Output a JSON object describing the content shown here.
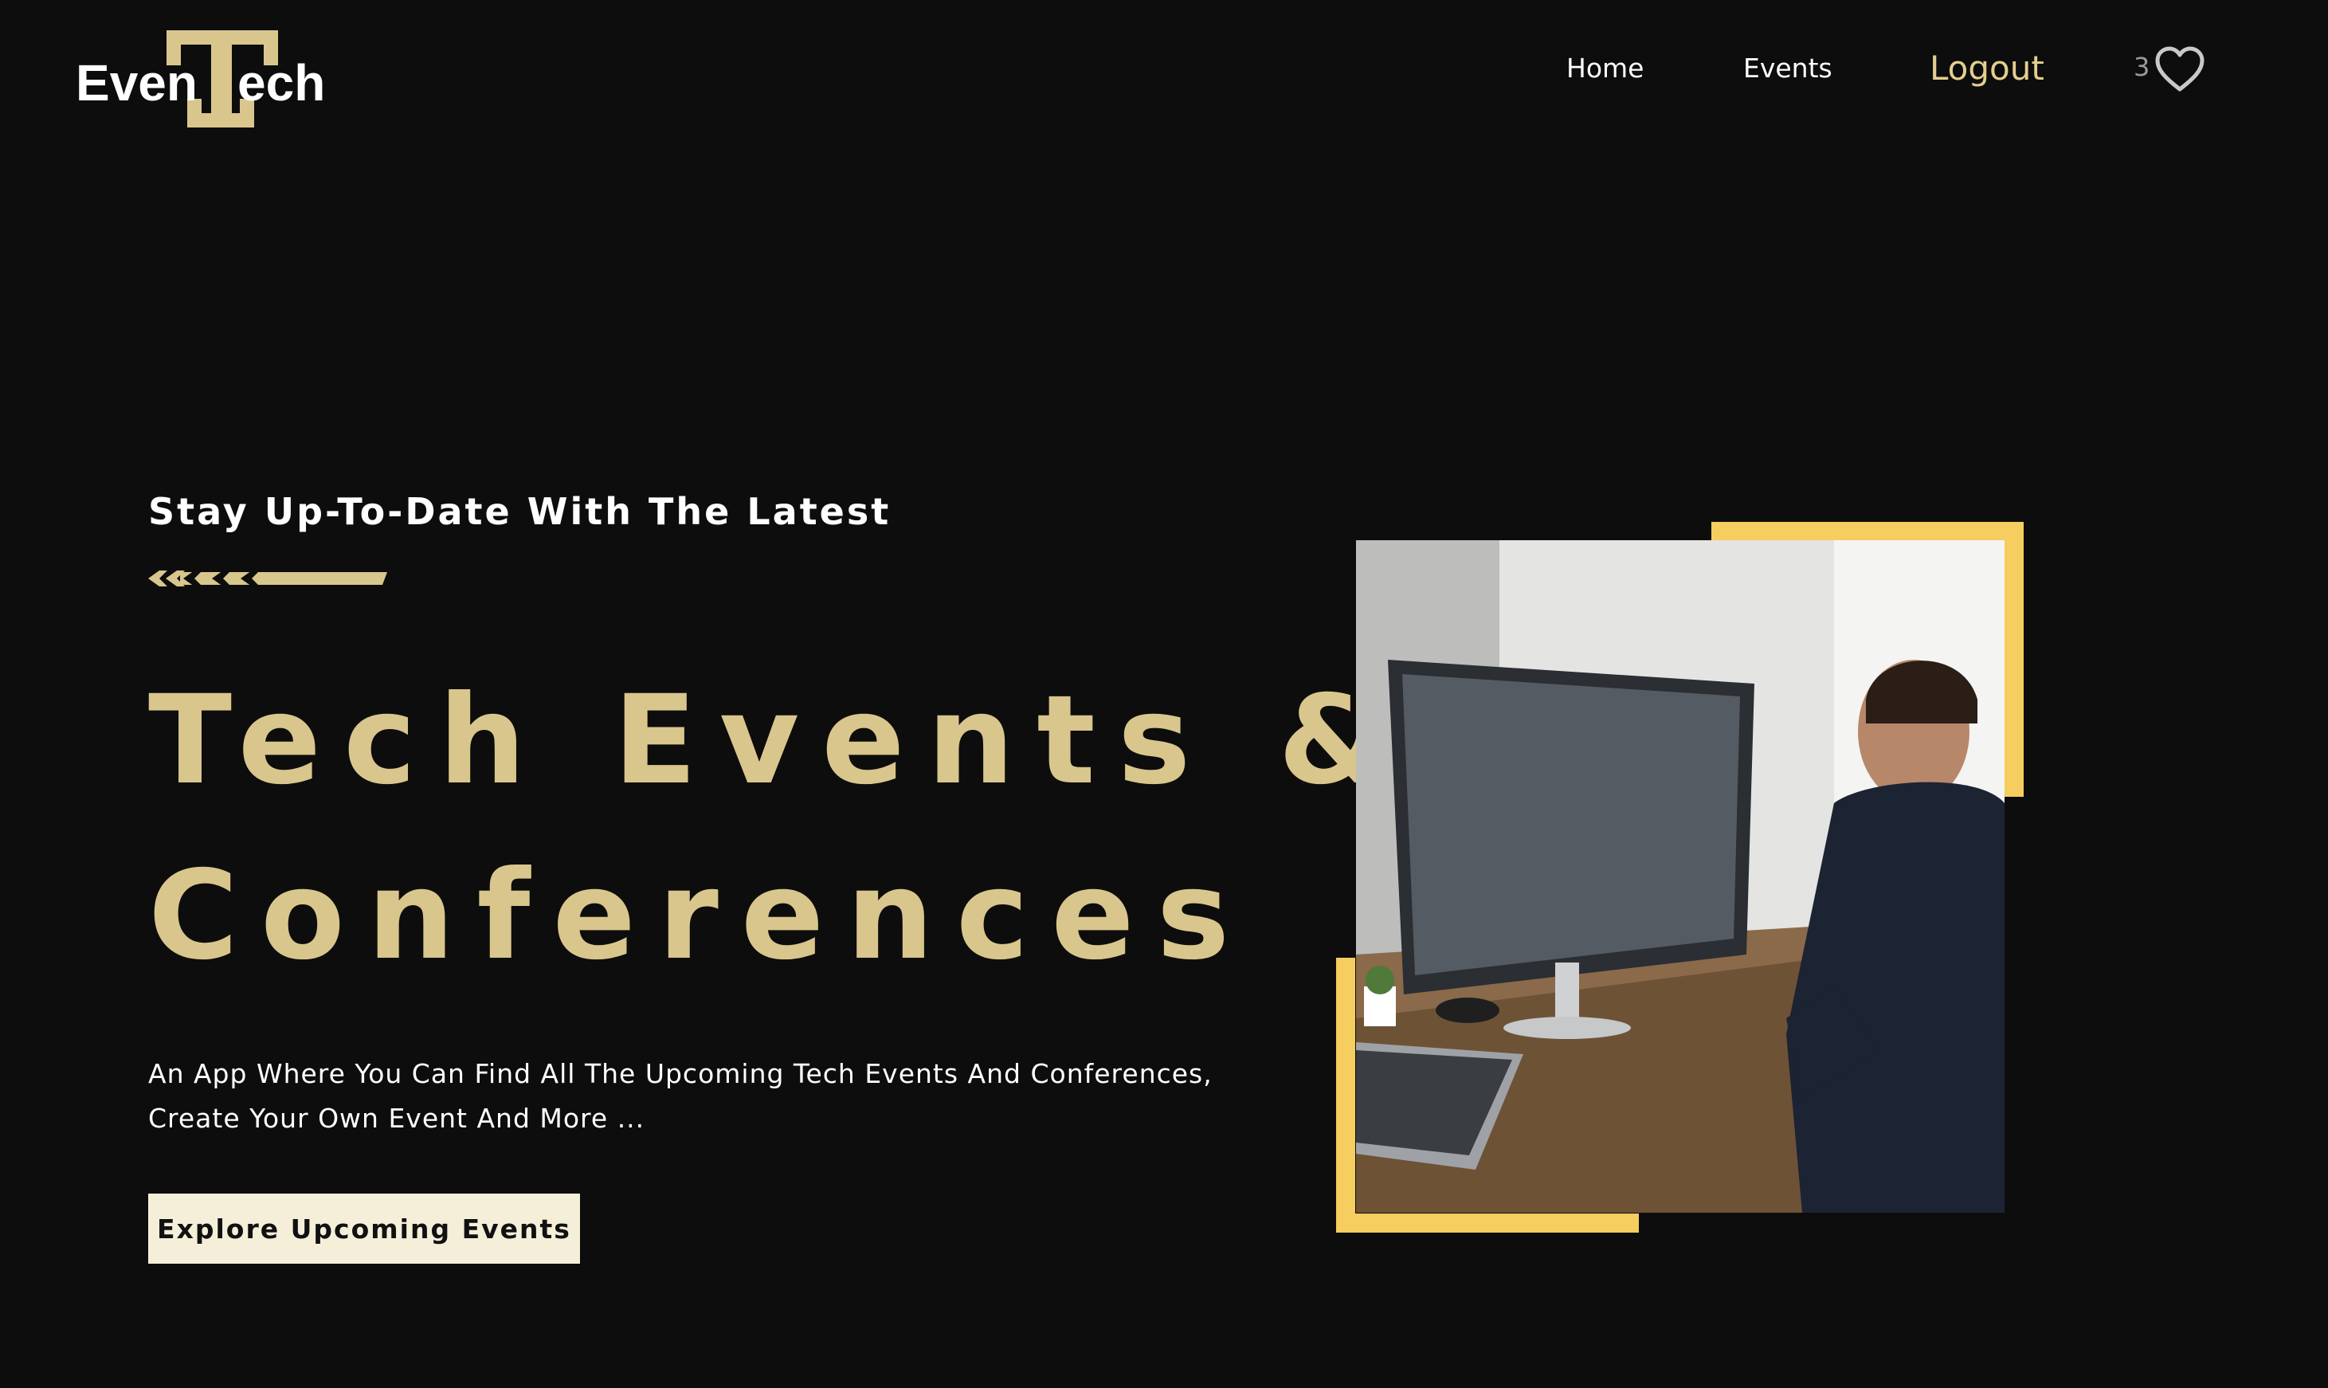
{
  "header": {
    "logo_text": "EvenTech",
    "nav": {
      "home": "Home",
      "events": "Events",
      "logout": "Logout"
    },
    "favorites_count": "3",
    "favorites_icon": "heart-icon"
  },
  "hero": {
    "subtitle": "Stay Up-To-Date With The Latest",
    "title_line1": "Tech Events &",
    "title_line2": "Conferences",
    "description_line1": "An App Where You Can Find All The Upcoming Tech Events And Conferences,",
    "description_line2": "Create Your Own Event And More ...",
    "cta_label": "Explore Upcoming Events"
  },
  "colors": {
    "background": "#0d0d0d",
    "accent_gold": "#d9c68c",
    "frame_yellow": "#f6cd5f",
    "button_bg": "#f5efd9"
  }
}
